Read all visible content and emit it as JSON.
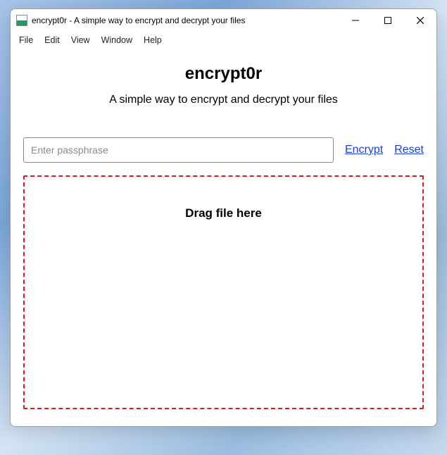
{
  "window": {
    "title": "encrypt0r - A simple way to encrypt and decrypt your files"
  },
  "menubar": {
    "items": [
      "File",
      "Edit",
      "View",
      "Window",
      "Help"
    ]
  },
  "main": {
    "heading": "encrypt0r",
    "subheading": "A simple way to encrypt and decrypt your files",
    "passphrase_placeholder": "Enter passphrase",
    "passphrase_value": "",
    "encrypt_label": "Encrypt",
    "reset_label": "Reset",
    "dropzone_label": "Drag file here"
  }
}
